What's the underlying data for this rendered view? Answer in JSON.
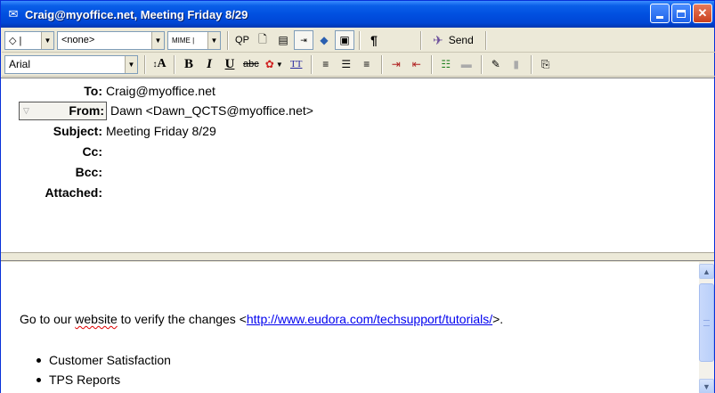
{
  "window": {
    "title": "Craig@myoffice.net, Meeting Friday 8/29",
    "icon": "envelope-icon"
  },
  "toolbar1": {
    "priority_value": "◇ |",
    "signature_value": "<none>",
    "encoding_value": "MIME |",
    "qp_label": "QP",
    "paragraph_label": "¶",
    "send_label": "Send"
  },
  "toolbar2": {
    "font_value": "Arial",
    "font_size_label": "A",
    "bold_label": "B",
    "italic_label": "I",
    "underline_label": "U",
    "strike_label": "abc",
    "tt_label": "TT"
  },
  "headers": {
    "to_label": "To:",
    "to_value": "Craig@myoffice.net",
    "from_label": "From:",
    "from_value": "Dawn <Dawn_QCTS@myoffice.net>",
    "subject_label": "Subject:",
    "subject_value": "Meeting Friday 8/29",
    "cc_label": "Cc:",
    "cc_value": "",
    "bcc_label": "Bcc:",
    "bcc_value": "",
    "attached_label": "Attached:",
    "attached_value": ""
  },
  "body": {
    "line_prefix": "Go to our ",
    "website_word": "website",
    "line_middle": " to verify the changes <",
    "link_text": "http://www.eudora.com/techsupport/tutorials/",
    "line_suffix": ">.",
    "bullets": [
      "Customer Satisfaction",
      "TPS Reports"
    ]
  }
}
